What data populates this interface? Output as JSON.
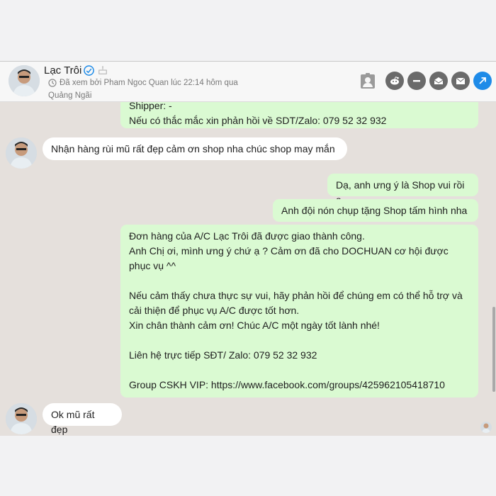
{
  "header": {
    "name": "Lạc Trôi",
    "seen_text": "Đã xem bởi Pham Ngoc Quan lúc 22:14 hôm qua",
    "location": "Quảng Ngãi"
  },
  "messages": {
    "m1": "Shipper: -\nNếu có thắc mắc xin phản hồi về SDT/Zalo: 079 52 32 932",
    "m2": "Nhận hàng rùi mũ rất đẹp cảm ơn shop nha chúc shop may mắn",
    "m3": "Dạ, anh ưng ý là Shop vui rồi ạ",
    "m4": "Anh đội nón chụp tặng Shop tấm hình nha",
    "m5": "Đơn hàng của A/C Lạc Trôi đã được giao thành công.\nAnh Chị ơi, mình ưng ý chứ ạ ? Cảm ơn đã cho DOCHUAN cơ hội được phục vụ ^^\n\nNếu cảm thấy chưa thực sự vui, hãy phản hồi để chúng em có thể hỗ trợ và cải thiện để phục vụ A/C được tốt hơn.\nXin chân thành cảm ơn! Chúc A/C một ngày tốt lành nhé!\n\nLiên hệ trực tiếp SĐT/ Zalo: 079 52 32 932\n\nGroup CSKH VIP: https://www.facebook.com/groups/425962105418710",
    "m6": "Ok mũ rất đẹp"
  },
  "colors": {
    "outgoing_bubble": "#dafad2",
    "incoming_bubble": "#ffffff",
    "chat_background": "#e5e0dc",
    "accent": "#1e8be8"
  },
  "icons": [
    "verified-icon",
    "cake-icon",
    "seen-icon",
    "contact-card-icon",
    "reddit-icon",
    "minus-icon",
    "mail-open-icon",
    "mail-icon",
    "share-icon"
  ]
}
